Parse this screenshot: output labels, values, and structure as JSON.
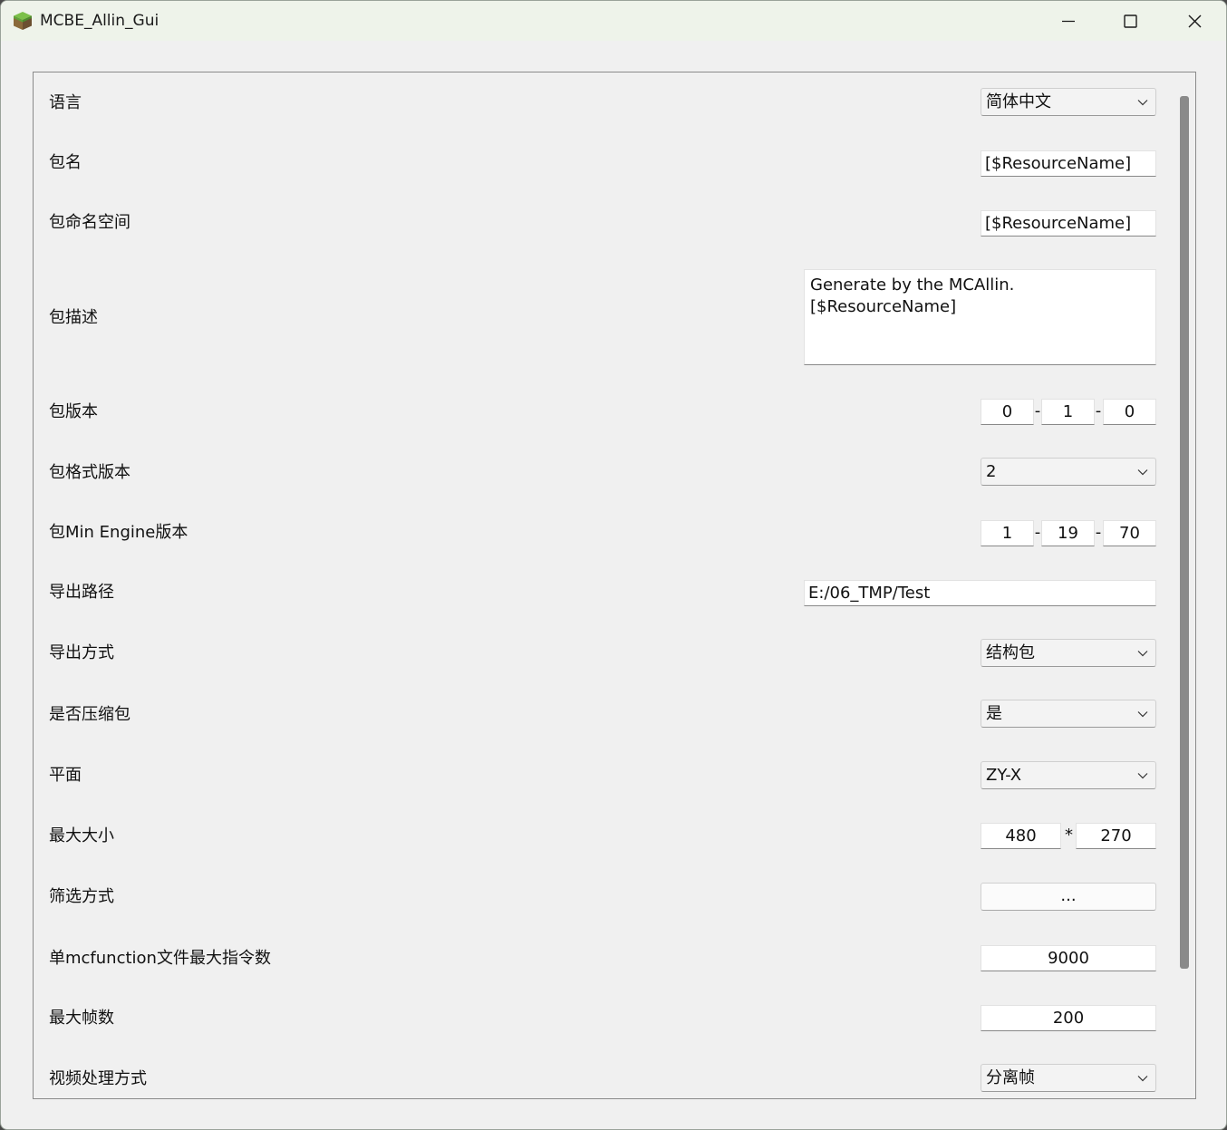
{
  "window": {
    "title": "MCBE_Allin_Gui",
    "icon": "grass-block-icon",
    "controls": [
      "minimize-icon",
      "maximize-icon",
      "close-icon"
    ]
  },
  "form": {
    "language": {
      "label": "语言",
      "value": "简体中文"
    },
    "pack_name": {
      "label": "包名",
      "value": "[$ResourceName]"
    },
    "pack_namespace": {
      "label": "包命名空间",
      "value": "[$ResourceName]"
    },
    "pack_description": {
      "label": "包描述",
      "line1": "Generate by the MCAllin.",
      "line2": "[$ResourceName]"
    },
    "pack_version": {
      "label": "包版本",
      "major": "0",
      "minor": "1",
      "patch": "0",
      "separator": "-"
    },
    "format_version": {
      "label": "包格式版本",
      "value": "2"
    },
    "min_engine_version": {
      "label": "包Min Engine版本",
      "major": "1",
      "minor": "19",
      "patch": "70",
      "separator": "-"
    },
    "export_path": {
      "label": "导出路径",
      "value": "E:/06_TMP/Test"
    },
    "export_mode": {
      "label": "导出方式",
      "value": "结构包"
    },
    "compress": {
      "label": "是否压缩包",
      "value": "是"
    },
    "plane": {
      "label": "平面",
      "value": "ZY-X"
    },
    "max_size": {
      "label": "最大大小",
      "width": "480",
      "height": "270",
      "separator": "*"
    },
    "filter_mode": {
      "label": "筛选方式",
      "button": "..."
    },
    "max_commands": {
      "label": "单mcfunction文件最大指令数",
      "value": "9000"
    },
    "max_frames": {
      "label": "最大帧数",
      "value": "200"
    },
    "video_mode": {
      "label": "视频处理方式",
      "value": "分离帧"
    }
  }
}
